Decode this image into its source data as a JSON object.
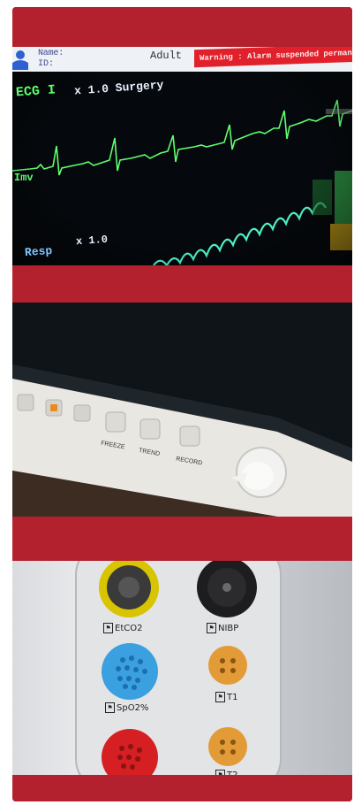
{
  "screen": {
    "patient": {
      "name_label": "Name:",
      "id_label": "ID:",
      "category": "Adult"
    },
    "warning_text": "Warning : Alarm suspended permanently",
    "ecg": {
      "lead": "ECG I",
      "scale": "x 1.0 Surgery",
      "marker": "Imv"
    },
    "resp": {
      "label": "Resp",
      "scale": "x 1.0"
    },
    "colors": {
      "ecg": "#5eff6f",
      "resp": "#4ef2c8",
      "warning_bg": "#e0212b"
    }
  },
  "monitor_front": {
    "buttons": [
      "FREEZE",
      "TREND",
      "RECORD"
    ]
  },
  "ports": {
    "etco2": "EtCO2",
    "nibp": "NIBP",
    "spo2": "SpO2%",
    "t1": "T1",
    "t2": "T2"
  },
  "colors": {
    "frame": "#b3202e"
  }
}
